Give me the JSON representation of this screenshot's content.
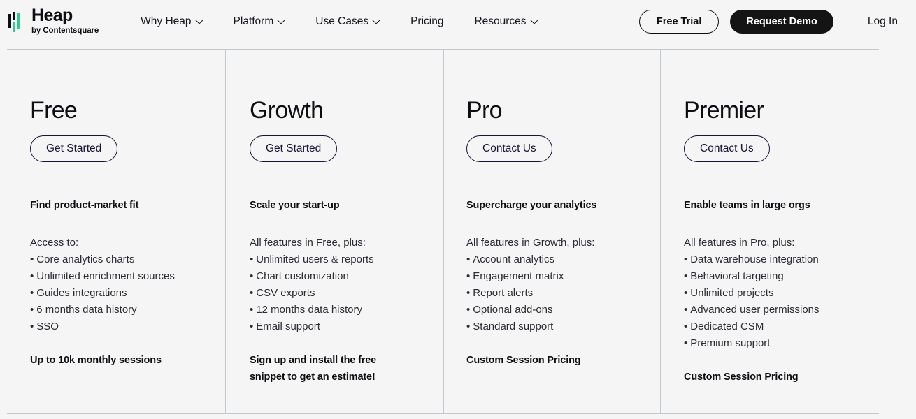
{
  "header": {
    "logo": {
      "name": "Heap",
      "subtitle": "by Contentsquare",
      "mark_icon": "heap-bars-icon",
      "accent_green": "#2ecc8f",
      "accent_dark": "#0d0d12"
    },
    "nav": [
      {
        "label": "Why Heap",
        "has_dropdown": true,
        "icon": "chevron-down-icon"
      },
      {
        "label": "Platform",
        "has_dropdown": true,
        "icon": "chevron-down-icon"
      },
      {
        "label": "Use Cases",
        "has_dropdown": true,
        "icon": "chevron-down-icon"
      },
      {
        "label": "Pricing",
        "has_dropdown": false
      },
      {
        "label": "Resources",
        "has_dropdown": true,
        "icon": "chevron-down-icon"
      }
    ],
    "free_trial_label": "Free Trial",
    "request_demo_label": "Request Demo",
    "login_label": "Log In"
  },
  "plans": [
    {
      "name": "Free",
      "cta_label": "Get Started",
      "tagline": "Find product-market fit",
      "intro": "Access to:",
      "features": [
        "Core analytics charts",
        "Unlimited enrichment sources",
        "Guides integrations",
        "6 months data history",
        "SSO"
      ],
      "footnote": "Up to 10k monthly sessions"
    },
    {
      "name": "Growth",
      "cta_label": "Get Started",
      "tagline": "Scale your start-up",
      "intro": "All features in Free, plus:",
      "features": [
        "Unlimited users & reports",
        "Chart customization",
        "CSV exports",
        "12 months data history",
        "Email support"
      ],
      "footnote": "Sign up and install the free snippet to get an estimate!"
    },
    {
      "name": "Pro",
      "cta_label": "Contact Us",
      "tagline": "Supercharge your analytics",
      "intro": "All features in Growth, plus:",
      "features": [
        "Account analytics",
        "Engagement matrix",
        "Report alerts",
        "Optional add-ons",
        "Standard support"
      ],
      "footnote": "Custom Session Pricing"
    },
    {
      "name": "Premier",
      "cta_label": "Contact Us",
      "tagline": "Enable teams in large orgs",
      "intro": "All features in Pro, plus:",
      "features": [
        "Data warehouse integration",
        "Behavioral targeting",
        "Unlimited projects",
        "Advanced user permissions",
        "Dedicated CSM",
        "Premium support"
      ],
      "footnote": "Custom Session Pricing"
    }
  ],
  "bullet_char": "•",
  "colors": {
    "page_background": "#f5f5f5",
    "rule": "#c3c8cf",
    "cta_border": "#1b1238",
    "text": "#2b2b33",
    "heading": "#0d0d12"
  }
}
